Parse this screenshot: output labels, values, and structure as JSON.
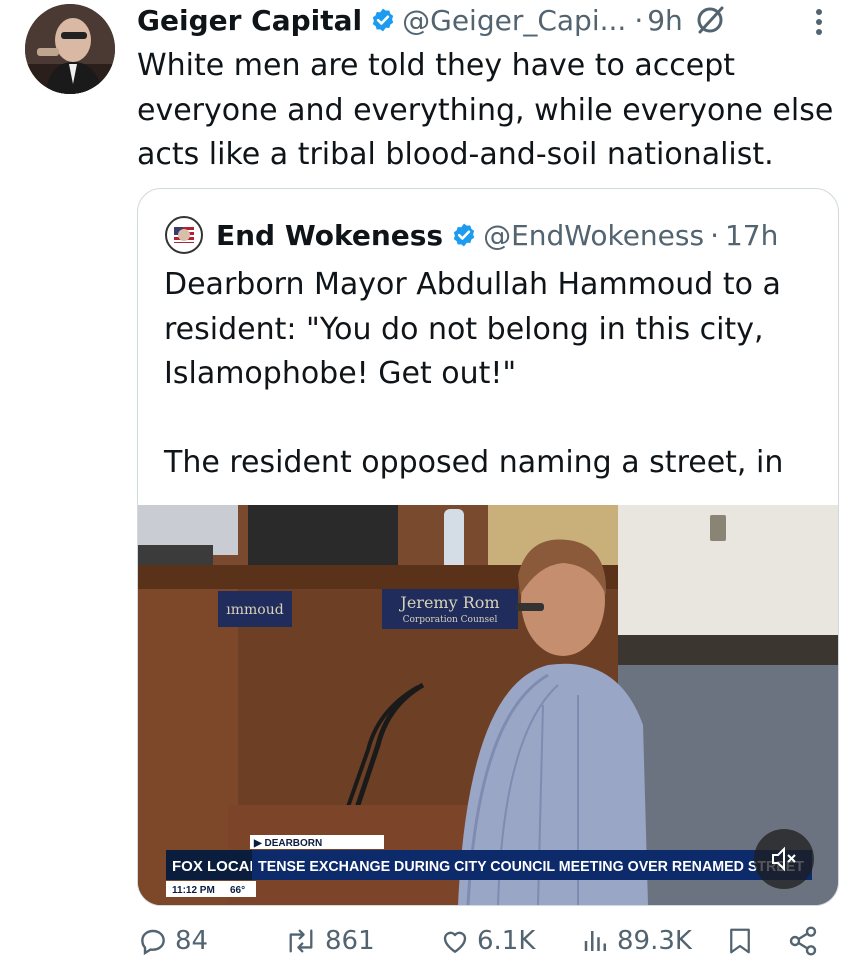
{
  "tweet": {
    "author_name": "Geiger Capital",
    "handle": "@Geiger_Capi...",
    "separator": "·",
    "time": "9h",
    "text": "White men are told they have to accept everyone and everything, while everyone else acts like a tribal blood-and-soil nationalist."
  },
  "quote": {
    "author_name": "End Wokeness",
    "handle": "@EndWokeness",
    "separator": "·",
    "time": "17h",
    "text": "Dearborn Mayor Abdullah Hammoud to a resident: \"You do not belong in this city, Islamophobe! Get out!\"\n\nThe resident opposed naming a street, in ...",
    "video": {
      "nameplate_left": "ımmoud",
      "nameplate_right": "Jeremy Rom",
      "nameplate_right_sub": "Corporation Counsel",
      "chyron_tag": "▶ DEARBORN",
      "chyron_logo": "FOX LOCAL",
      "chyron_headline": "TENSE EXCHANGE DURING CITY COUNCIL MEETING OVER RENAMED STREET",
      "chyron_time": "11:12 PM",
      "chyron_temp": "66°"
    }
  },
  "actions": {
    "replies": "84",
    "reposts": "861",
    "likes": "6.1K",
    "views": "89.3K"
  },
  "colors": {
    "text": "#0f1419",
    "secondary": "#536471",
    "verified": "#1d9bf0",
    "border": "#cfd9de"
  }
}
